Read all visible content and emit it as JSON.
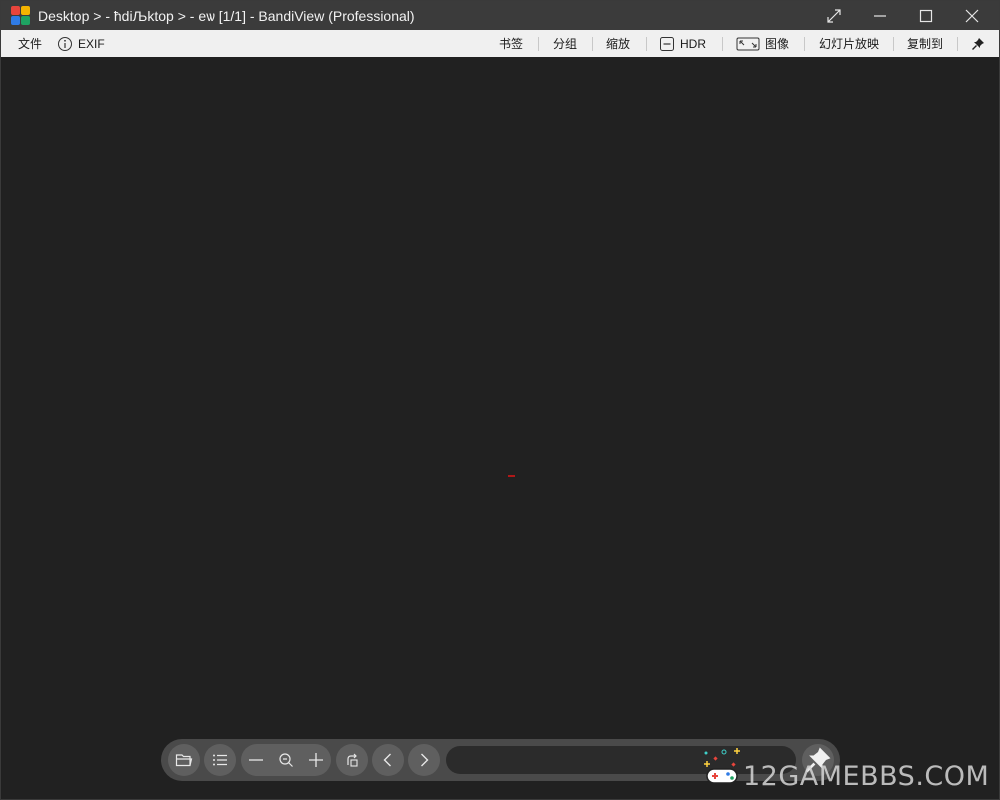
{
  "window": {
    "title": "Desktop > - ħdiЉktop > - eѡ [1/1] - BandiView (Professional)",
    "logo_colors": [
      "#e8453c",
      "#f4b400",
      "#1ea362",
      "#2f7be5"
    ]
  },
  "menubar": {
    "file": "文件",
    "exif": "EXIF",
    "bookmark": "书签",
    "group": "分组",
    "zoom": "缩放",
    "hdr": "HDR",
    "image": "图像",
    "slideshow": "幻灯片放映",
    "copy_to": "复制到"
  },
  "toolbar": {
    "icons": [
      "open-folder-icon",
      "list-icon",
      "zoom-out-icon",
      "zoom-fit-icon",
      "zoom-in-icon",
      "rotate-icon",
      "prev-icon",
      "next-icon",
      "pin-icon"
    ]
  },
  "watermark": {
    "text": "12GAMEBBS.COM"
  },
  "colors": {
    "titlebar": "#3b3b3b",
    "menubar": "#f0f0f0",
    "canvas": "#212121",
    "toolbar": "#4a4a4a"
  }
}
